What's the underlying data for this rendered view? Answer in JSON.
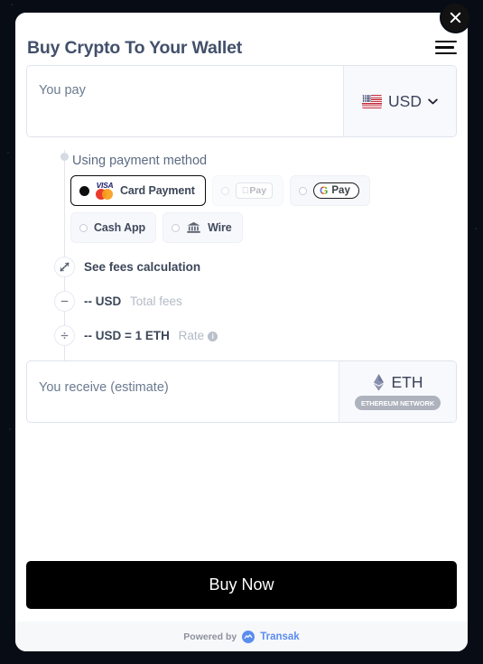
{
  "header": {
    "title": "Buy Crypto To Your Wallet",
    "menu_icon": "hamburger-menu-icon",
    "close_icon": "close-icon"
  },
  "pay": {
    "label": "You pay",
    "value": "",
    "currency_code": "USD",
    "currency_flag": "us-flag-icon",
    "chevron_icon": "chevron-down-icon"
  },
  "payment_methods": {
    "label": "Using payment method",
    "options": [
      {
        "id": "card",
        "label": "Card Payment",
        "selected": true,
        "disabled": false,
        "logo": "visa-mastercard-logo"
      },
      {
        "id": "applepay",
        "label": "Pay",
        "selected": false,
        "disabled": true,
        "logo": "apple-pay-logo"
      },
      {
        "id": "googlepay",
        "label": "Pay",
        "selected": false,
        "disabled": false,
        "logo": "google-pay-logo"
      },
      {
        "id": "cashapp",
        "label": "Cash App",
        "selected": false,
        "disabled": false,
        "logo": ""
      },
      {
        "id": "wire",
        "label": "Wire",
        "selected": false,
        "disabled": false,
        "logo": "bank-icon"
      }
    ]
  },
  "fees": {
    "see_fees_label": "See fees calculation",
    "total_fees_value": "-- USD",
    "total_fees_label": "Total fees",
    "rate_value": "-- USD = 1 ETH",
    "rate_label": "Rate",
    "info_icon": "info-icon",
    "icons": {
      "expand": "expand-arrows-icon",
      "minus": "minus-icon",
      "divide": "divide-icon"
    }
  },
  "receive": {
    "label": "You receive (estimate)",
    "value": "",
    "crypto_code": "ETH",
    "crypto_icon": "ethereum-icon",
    "network_badge": "ETHEREUM NETWORK"
  },
  "actions": {
    "buy_label": "Buy Now"
  },
  "footer": {
    "powered_by": "Powered by",
    "brand": "Transak",
    "brand_icon": "transak-logo-icon"
  },
  "colors": {
    "accent": "#5b8def",
    "title": "#43506b",
    "button": "#000000",
    "page_background": "#080d15"
  }
}
